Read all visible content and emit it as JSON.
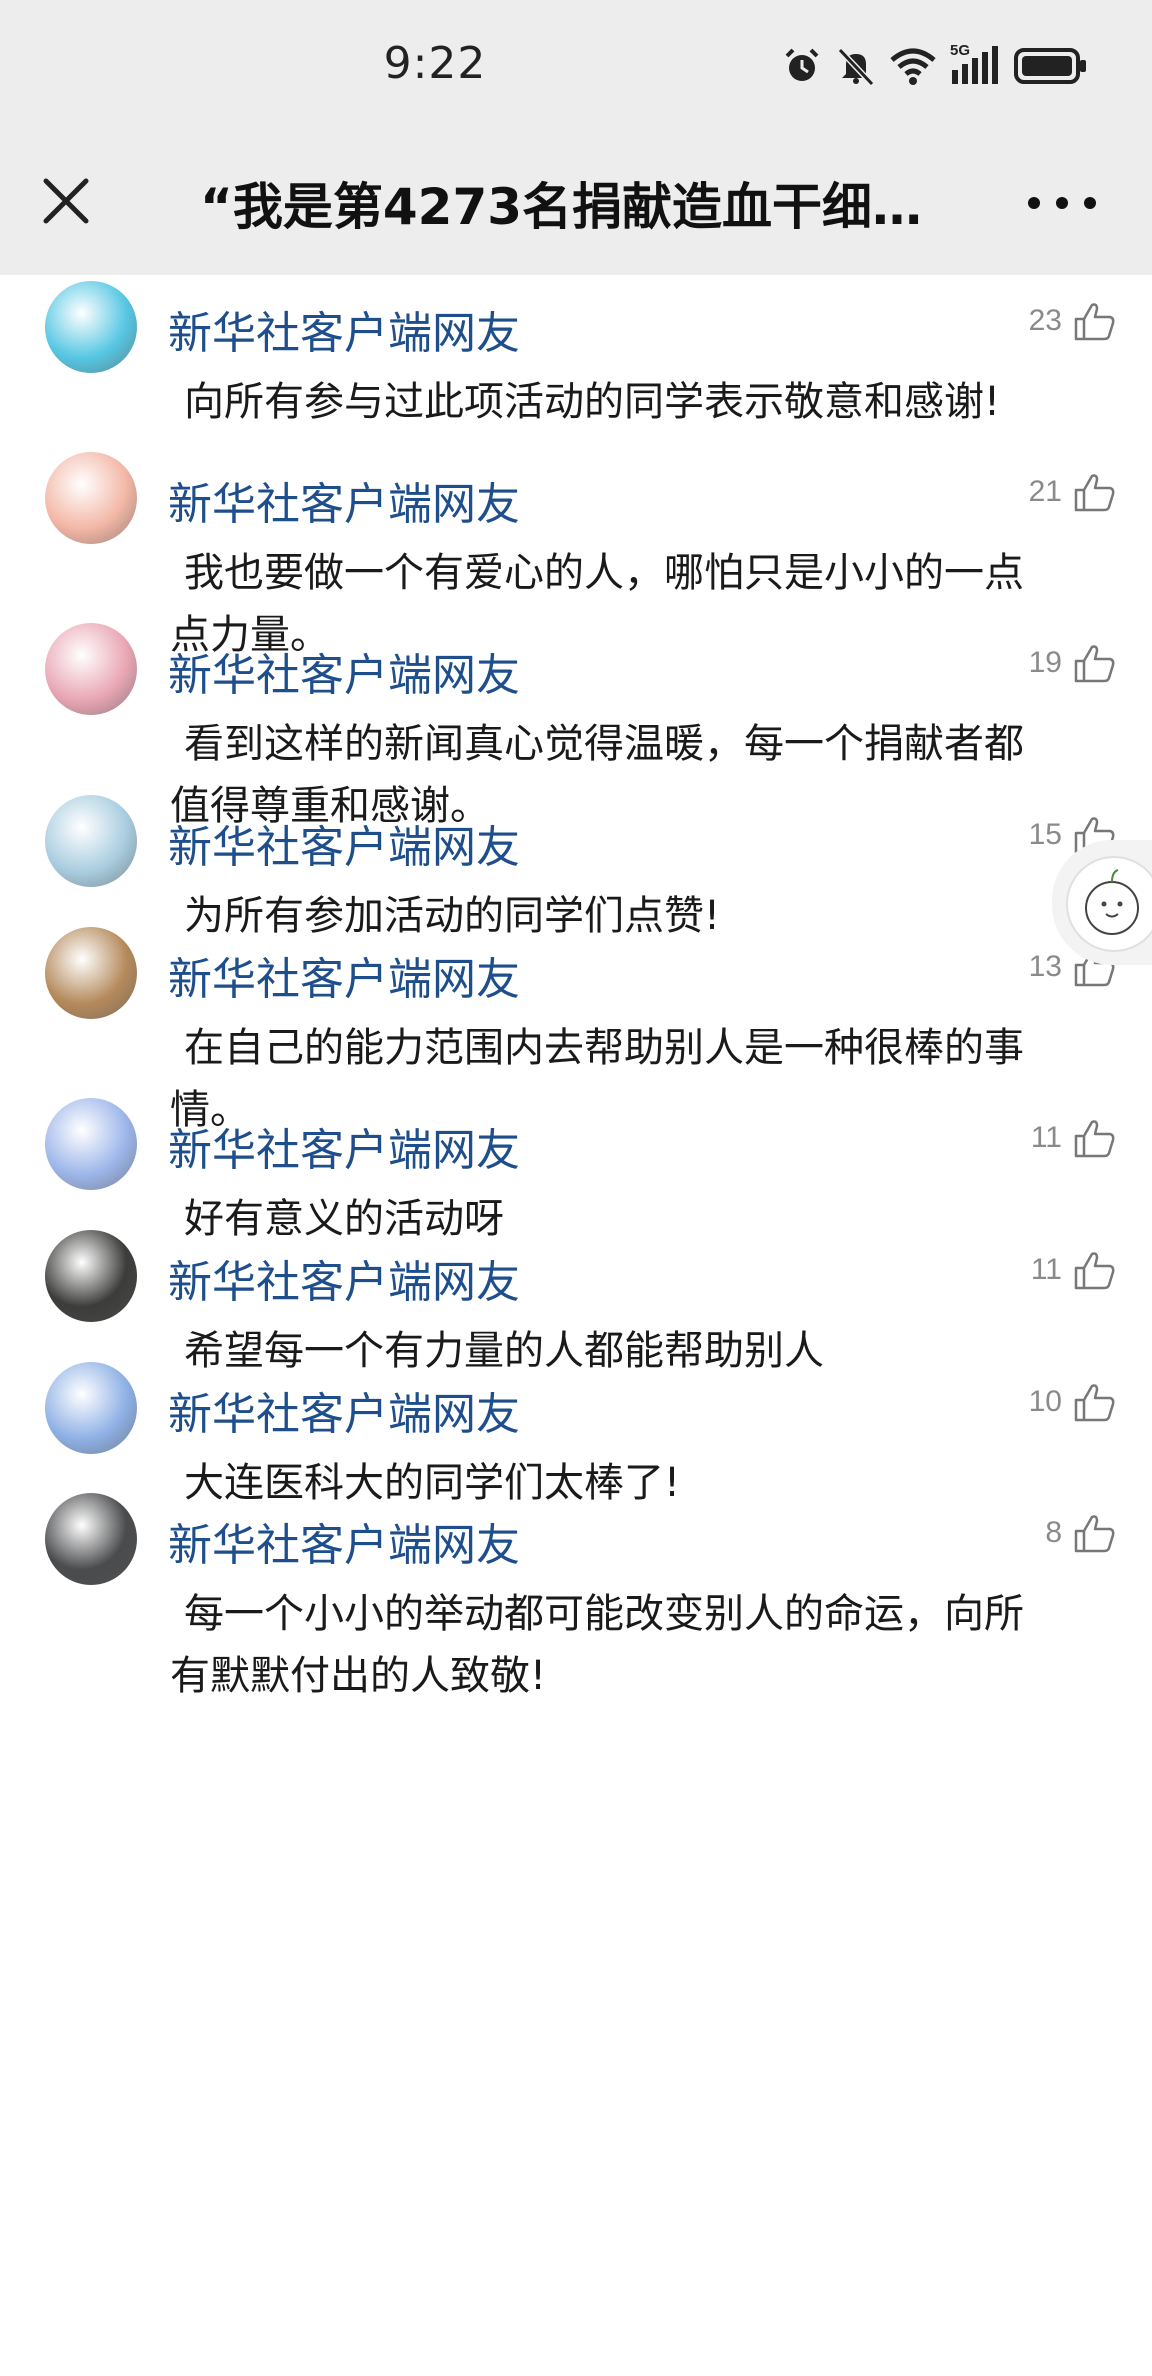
{
  "status_bar": {
    "time": "9:22",
    "network_label": "5G",
    "icons": [
      "alarm-icon",
      "mute-icon",
      "wifi-icon",
      "signal-icon",
      "battery-icon"
    ]
  },
  "nav": {
    "title": "“我是第4273名捐献造血干细…",
    "close_icon": "close-icon",
    "more_icon": "more-icon"
  },
  "comments": [
    {
      "user": "新华社客户端网友",
      "likes": "23",
      "text": "向所有参与过此项活动的同学表示敬意和感谢!",
      "avatar_color": "#57c7e3"
    },
    {
      "user": "新华社客户端网友",
      "likes": "21",
      "text": "我也要做一个有爱心的人，哪怕只是小小的一点点力量。",
      "avatar_color": "#f3b7a6"
    },
    {
      "user": "新华社客户端网友",
      "likes": "19",
      "text": "看到这样的新闻真心觉得温暖，每一个捐献者都值得尊重和感谢。",
      "avatar_color": "#e9a7b4"
    },
    {
      "user": "新华社客户端网友",
      "likes": "15",
      "text": "为所有参加活动的同学们点赞!",
      "avatar_color": "#a9cde0"
    },
    {
      "user": "新华社客户端网友",
      "likes": "13",
      "text": "在自己的能力范围内去帮助别人是一种很棒的事情。",
      "avatar_color": "#b58a5c"
    },
    {
      "user": "新华社客户端网友",
      "likes": "11",
      "text": "好有意义的活动呀",
      "avatar_color": "#9db6ea"
    },
    {
      "user": "新华社客户端网友",
      "likes": "11",
      "text": "希望每一个有力量的人都能帮助别人",
      "avatar_color": "#3c3c3a"
    },
    {
      "user": "新华社客户端网友",
      "likes": "10",
      "text": "大连医科大的同学们太棒了!",
      "avatar_color": "#8fb1e6"
    },
    {
      "user": "新华社客户端网友",
      "likes": "8",
      "text": "每一个小小的举动都可能改变别人的命运，向所有默默付出的人致敬!",
      "avatar_color": "#4a4b4d"
    }
  ],
  "colors": {
    "username": "#1e4f8c",
    "text": "#1a1a1a",
    "like_count": "#8a8a8a",
    "bar_bg": "#ededed"
  }
}
